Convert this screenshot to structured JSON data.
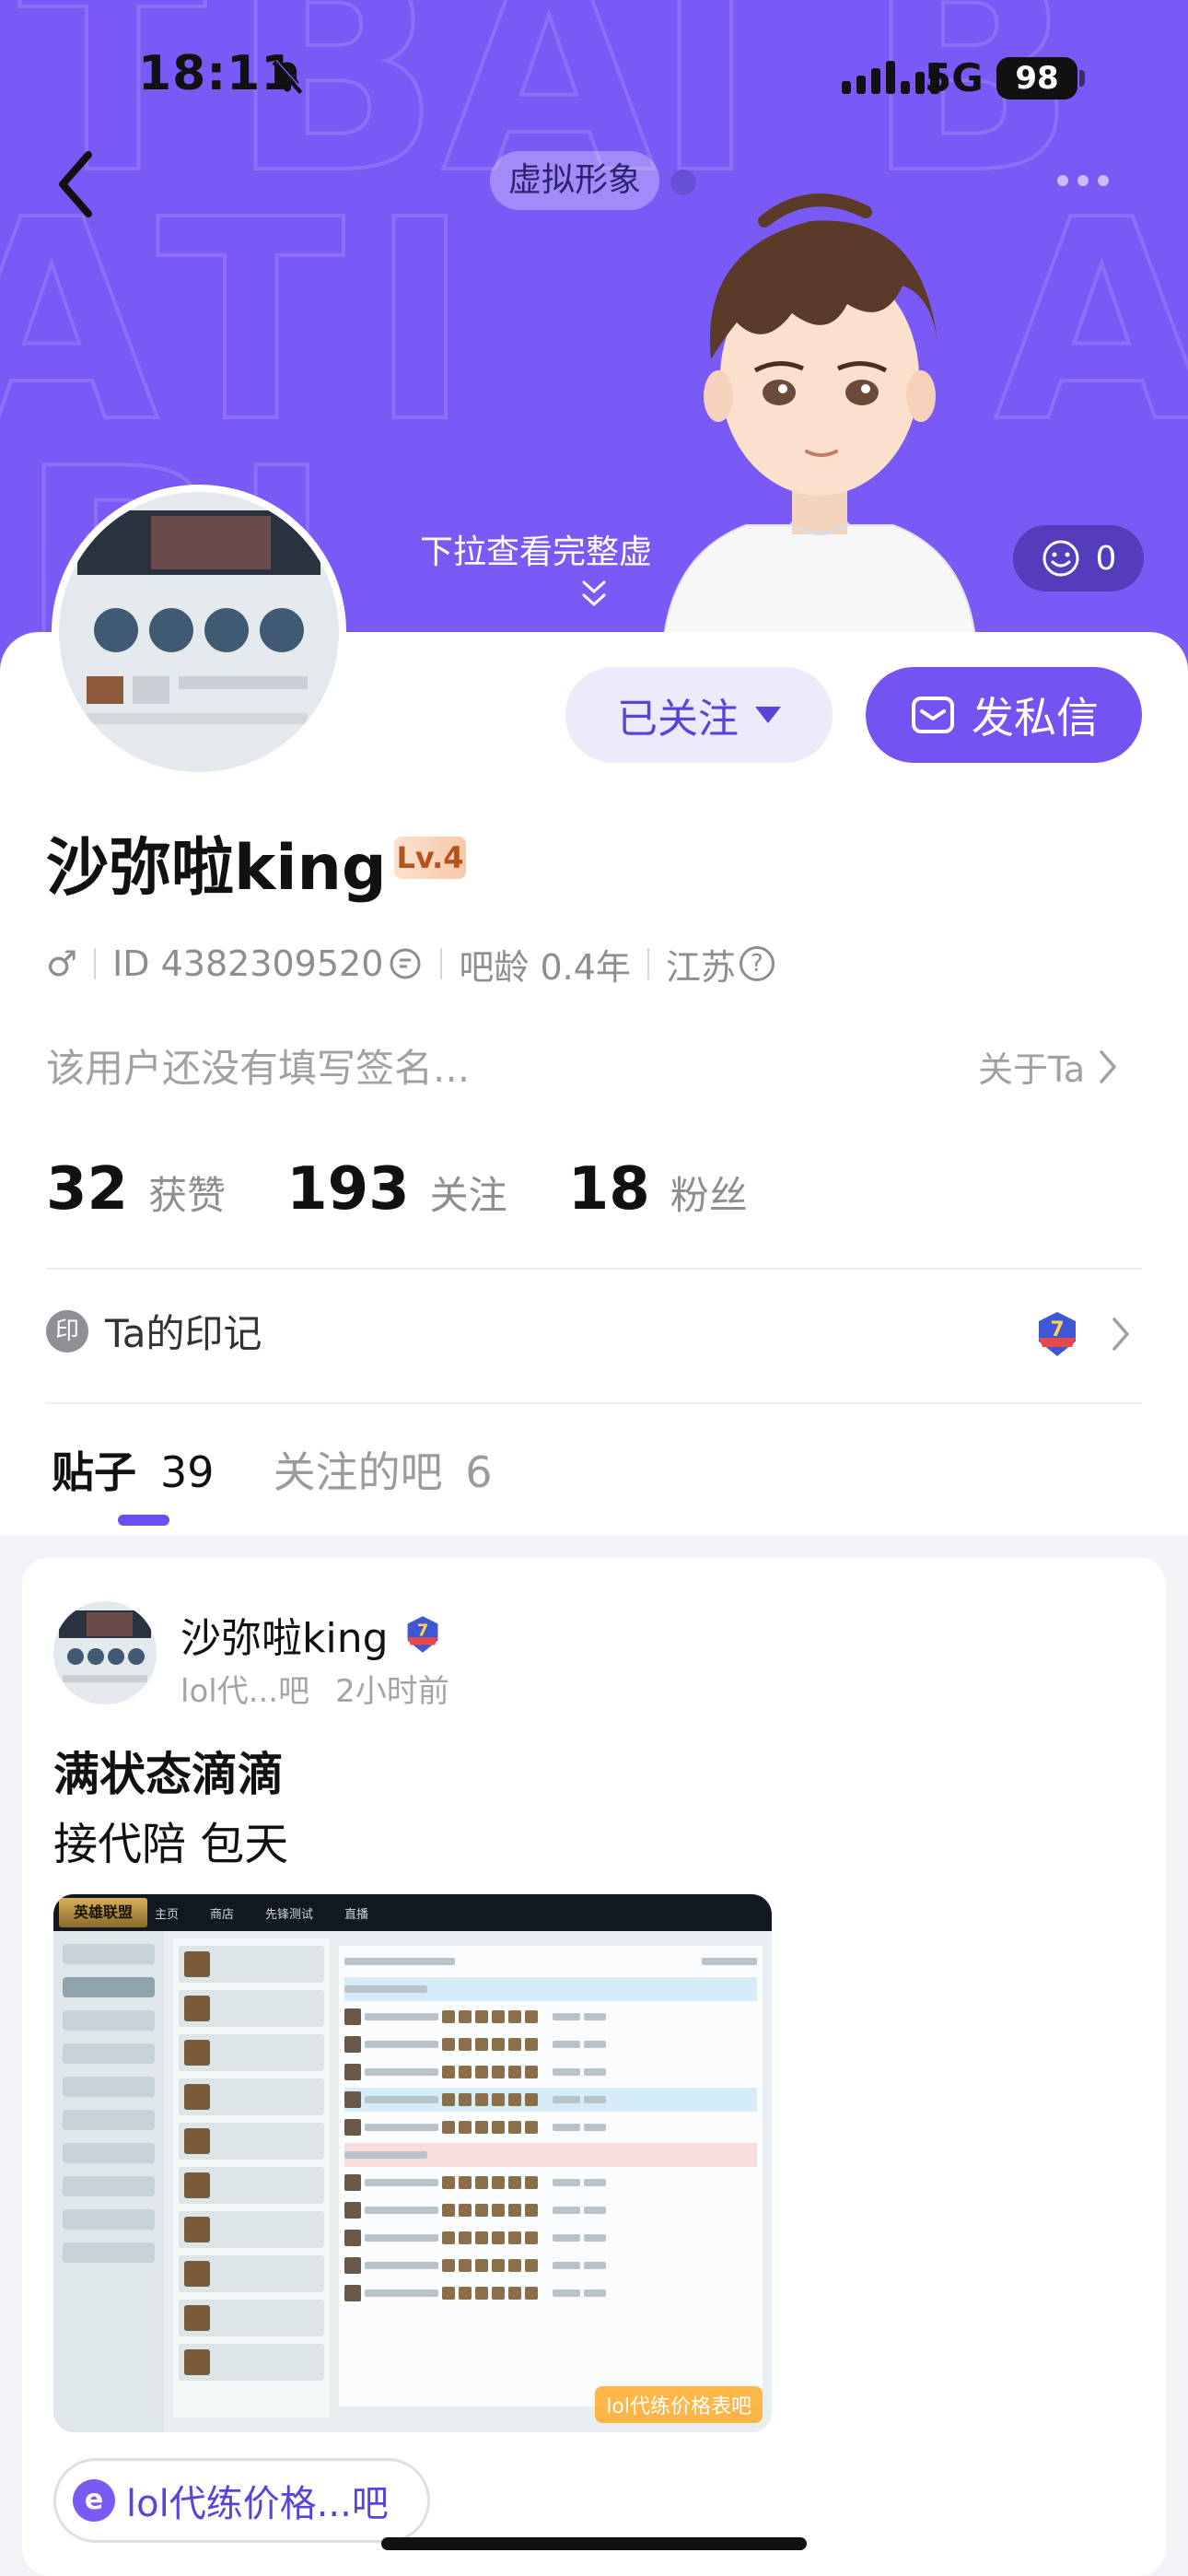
{
  "status_bar": {
    "time": "18:11",
    "network": "5G",
    "battery": "98"
  },
  "header": {
    "avatar_pill": "虚拟形象",
    "pull_hint": "下拉查看完整虚",
    "reaction_count": "0"
  },
  "profile": {
    "follow_button": "已关注",
    "message_button": "发私信",
    "username": "沙弥啦king",
    "level": "Lv.4",
    "gender": "♂",
    "id": "ID 4382309520",
    "forum_age": "吧龄 0.4年",
    "location": "江苏",
    "signature": "该用户还没有填写签名...",
    "about_link": "关于Ta",
    "stats": [
      {
        "value": "32",
        "label": "获赞"
      },
      {
        "value": "193",
        "label": "关注"
      },
      {
        "value": "18",
        "label": "粉丝"
      }
    ],
    "imprint_icon": "印",
    "imprint_label": "Ta的印记"
  },
  "tabs": [
    {
      "label": "贴子",
      "count": "39"
    },
    {
      "label": "关注的吧",
      "count": "6"
    }
  ],
  "post": {
    "author": "沙弥啦king",
    "forum_short": "lol代...吧",
    "time_ago": "2小时前",
    "title": "满状态滴滴",
    "body": "接代陪 包天",
    "screenshot": {
      "logo": "英雄联盟",
      "nav": [
        "主页",
        "商店",
        "先锋测试",
        "直播"
      ],
      "watermark": "lol代练价格表吧"
    },
    "forum_chip": "lol代练价格...吧",
    "forum_chip_icon": "e"
  },
  "colors": {
    "brand": "#7354f2",
    "header_bg": "#7a5af5"
  }
}
